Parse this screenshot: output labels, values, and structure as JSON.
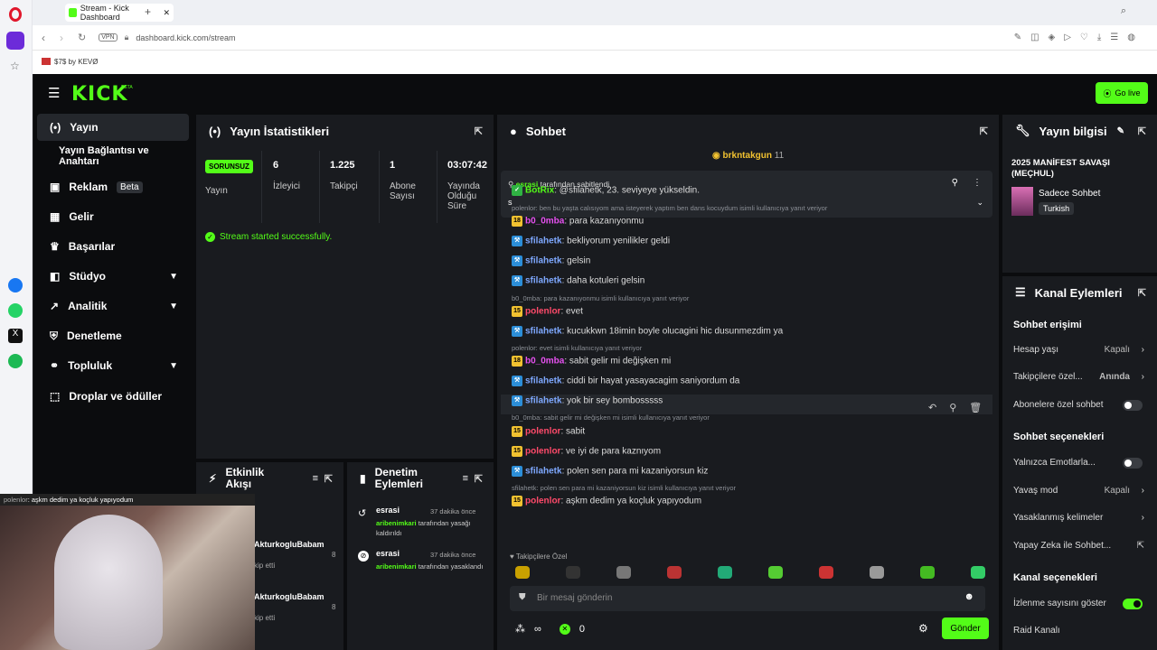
{
  "browser": {
    "tab_title": "Stream - Kick Dashboard",
    "url": "dashboard.kick.com/stream",
    "vpn": "VPN",
    "bookmark": "$7$ by KEVØ"
  },
  "app": {
    "logo": "KICK",
    "logo_badge": "BETA",
    "go_live": "Go live"
  },
  "sidebar": {
    "items": [
      {
        "label": "Yayın",
        "icon": "stream-icon"
      },
      {
        "label": "Yayın Bağlantısı ve Anahtarı",
        "icon": ""
      },
      {
        "label": "Reklam",
        "icon": "ad-icon"
      },
      {
        "label": "Gelir",
        "icon": "revenue-icon"
      },
      {
        "label": "Başarılar",
        "icon": "trophy-icon"
      },
      {
        "label": "Stüdyo",
        "icon": "studio-icon"
      },
      {
        "label": "Analitik",
        "icon": "chart-icon"
      },
      {
        "label": "Denetleme",
        "icon": "shield-icon"
      },
      {
        "label": "Topluluk",
        "icon": "community-icon"
      },
      {
        "label": "Droplar ve ödüller",
        "icon": "gift-icon"
      }
    ],
    "beta": "Beta"
  },
  "stats": {
    "title": "Yayın İstatistikleri",
    "badge": "SORUNSUZ",
    "stream_label": "Yayın",
    "viewers": {
      "value": "6",
      "label": "İzleyici"
    },
    "followers": {
      "value": "1.225",
      "label": "Takipçi"
    },
    "subs": {
      "value": "1",
      "label": "Abone Sayısı"
    },
    "uptime": {
      "value": "03:07:42",
      "label": "Yayında Olduğu Süre"
    },
    "success": "Stream started successfully."
  },
  "activity": {
    "title": "Etkinlik Akışı",
    "items": [
      {
        "name": "AkturkogluBabam",
        "sub": "kip etti",
        "count": "8"
      },
      {
        "name": "AkturkogluBabam",
        "sub": "kip etti",
        "count": "8"
      }
    ]
  },
  "moderation": {
    "title": "Denetim Eylemleri",
    "items": [
      {
        "user": "esrasi",
        "time": "37 dakika önce",
        "target": "aribenimkari",
        "text1": "tarafından",
        "text2": "yasağı kaldırıldı"
      },
      {
        "user": "esrasi",
        "time": "37 dakika önce",
        "target": "aribenimkari",
        "text1": "tarafından",
        "text2": "yasaklandı"
      }
    ]
  },
  "chat": {
    "title": "Sohbet",
    "top_user": "brkntakgun",
    "top_count": "11",
    "pinned_by": "esrasi",
    "pinned_text": "tarafından sabitlendi",
    "pinned_msg": "s",
    "lines": [
      {
        "type": "msg",
        "badge": "green",
        "name": "BotRix",
        "cls": "name-green",
        "text": ": @sfilahetk, 23. seviyeye yükseldin."
      },
      {
        "type": "reply",
        "text": "polenlor: ben bu yaşta calısıyom ama isteyerek yaptım ben dans kocuydum isimli kullanıcıya yanıt veriyor"
      },
      {
        "type": "msg",
        "badge": "yellow",
        "badge_text": "18",
        "name": "b0_0mba",
        "cls": "name-pink",
        "text": ": para kazanıyonmu"
      },
      {
        "type": "msg",
        "badge": "blue",
        "name": "sfilahetk",
        "cls": "name-blue",
        "text": ": bekliyorum yenilikler geldi"
      },
      {
        "type": "msg",
        "badge": "blue",
        "name": "sfilahetk",
        "cls": "name-blue",
        "text": ": gelsin"
      },
      {
        "type": "msg",
        "badge": "blue",
        "name": "sfilahetk",
        "cls": "name-blue",
        "text": ": daha kotuleri gelsin"
      },
      {
        "type": "reply",
        "text": "b0_0mba: para kazanıyonmu isimli kullanıcıya yanıt veriyor"
      },
      {
        "type": "msg",
        "badge": "yellow",
        "badge_text": "15",
        "name": "polenlor",
        "cls": "name-red",
        "text": ": evet"
      },
      {
        "type": "msg",
        "badge": "blue",
        "name": "sfilahetk",
        "cls": "name-blue",
        "text": ": kucukkwn 18imin boyle olucagini hic dusunmezdim ya"
      },
      {
        "type": "reply",
        "text": "polenlor: evet isimli kullanıcıya yanıt veriyor"
      },
      {
        "type": "msg",
        "badge": "yellow",
        "badge_text": "18",
        "name": "b0_0mba",
        "cls": "name-pink",
        "text": ": sabit gelir mi değişken mi"
      },
      {
        "type": "msg",
        "badge": "blue",
        "name": "sfilahetk",
        "cls": "name-blue",
        "text": ": ciddi bir hayat yasayacagim saniyordum da"
      },
      {
        "type": "msg",
        "badge": "blue",
        "name": "sfilahetk",
        "cls": "name-blue",
        "text": ": yok bir sey bombosssss"
      },
      {
        "type": "reply",
        "text": "b0_0mba: sabit gelir mi değişken mi isimli kullanıcıya yanıt veriyor"
      },
      {
        "type": "msg",
        "badge": "yellow",
        "badge_text": "15",
        "name": "polenlor",
        "cls": "name-red",
        "text": ": sabit"
      },
      {
        "type": "msg",
        "badge": "yellow",
        "badge_text": "15",
        "name": "polenlor",
        "cls": "name-red",
        "text": ": ve iyi de para kaznıyom"
      },
      {
        "type": "msg",
        "badge": "blue",
        "name": "sfilahetk",
        "cls": "name-blue",
        "text": ": polen sen para mi kazaniyorsun kiz"
      },
      {
        "type": "reply",
        "text": "sfilahetk: polen sen para mi kazaniyorsun kiz isimli kullanıcıya yanıt veriyor"
      },
      {
        "type": "msg",
        "badge": "yellow",
        "badge_text": "15",
        "name": "polenlor",
        "cls": "name-red",
        "text": ": aşkm dedim ya koçluk yapıyodum"
      }
    ],
    "followers_only": "Takipçilere Özel",
    "input_placeholder": "Bir mesaj gönderin",
    "count_inf": "∞",
    "count_zero": "0",
    "send": "Gönder"
  },
  "stream_info": {
    "title": "Yayın bilgisi",
    "stream_title": "2025 MANİFEST SAVAŞI (MEÇHUL)",
    "category": "Sadece Sohbet",
    "language": "Turkish"
  },
  "channel_actions": {
    "title": "Kanal Eylemleri",
    "chat_access": "Sohbet erişimi",
    "account_age": {
      "label": "Hesap yaşı",
      "value": "Kapalı"
    },
    "followers_only": {
      "label": "Takipçilere özel...",
      "value": "Anında"
    },
    "subs_only": {
      "label": "Abonelere özel sohbet"
    },
    "chat_options": "Sohbet seçenekleri",
    "emote_only": {
      "label": "Yalnızca Emotlarla..."
    },
    "slow_mode": {
      "label": "Yavaş mod",
      "value": "Kapalı"
    },
    "banned_words": {
      "label": "Yasaklanmış kelimeler"
    },
    "ai_chat": {
      "label": "Yapay Zeka ile Sohbet..."
    },
    "channel_options": "Kanal seçenekleri",
    "show_viewers": {
      "label": "İzlenme sayısını göster"
    },
    "raid": {
      "label": "Raid Kanalı"
    }
  },
  "webcam": {
    "caption_user": "polenlor",
    "caption_text": ": aşkm dedim ya koçluk yapıyodum"
  },
  "colors": {
    "accent": "#53fc18",
    "panel": "#191b1f",
    "bg": "#0b0c0e"
  }
}
